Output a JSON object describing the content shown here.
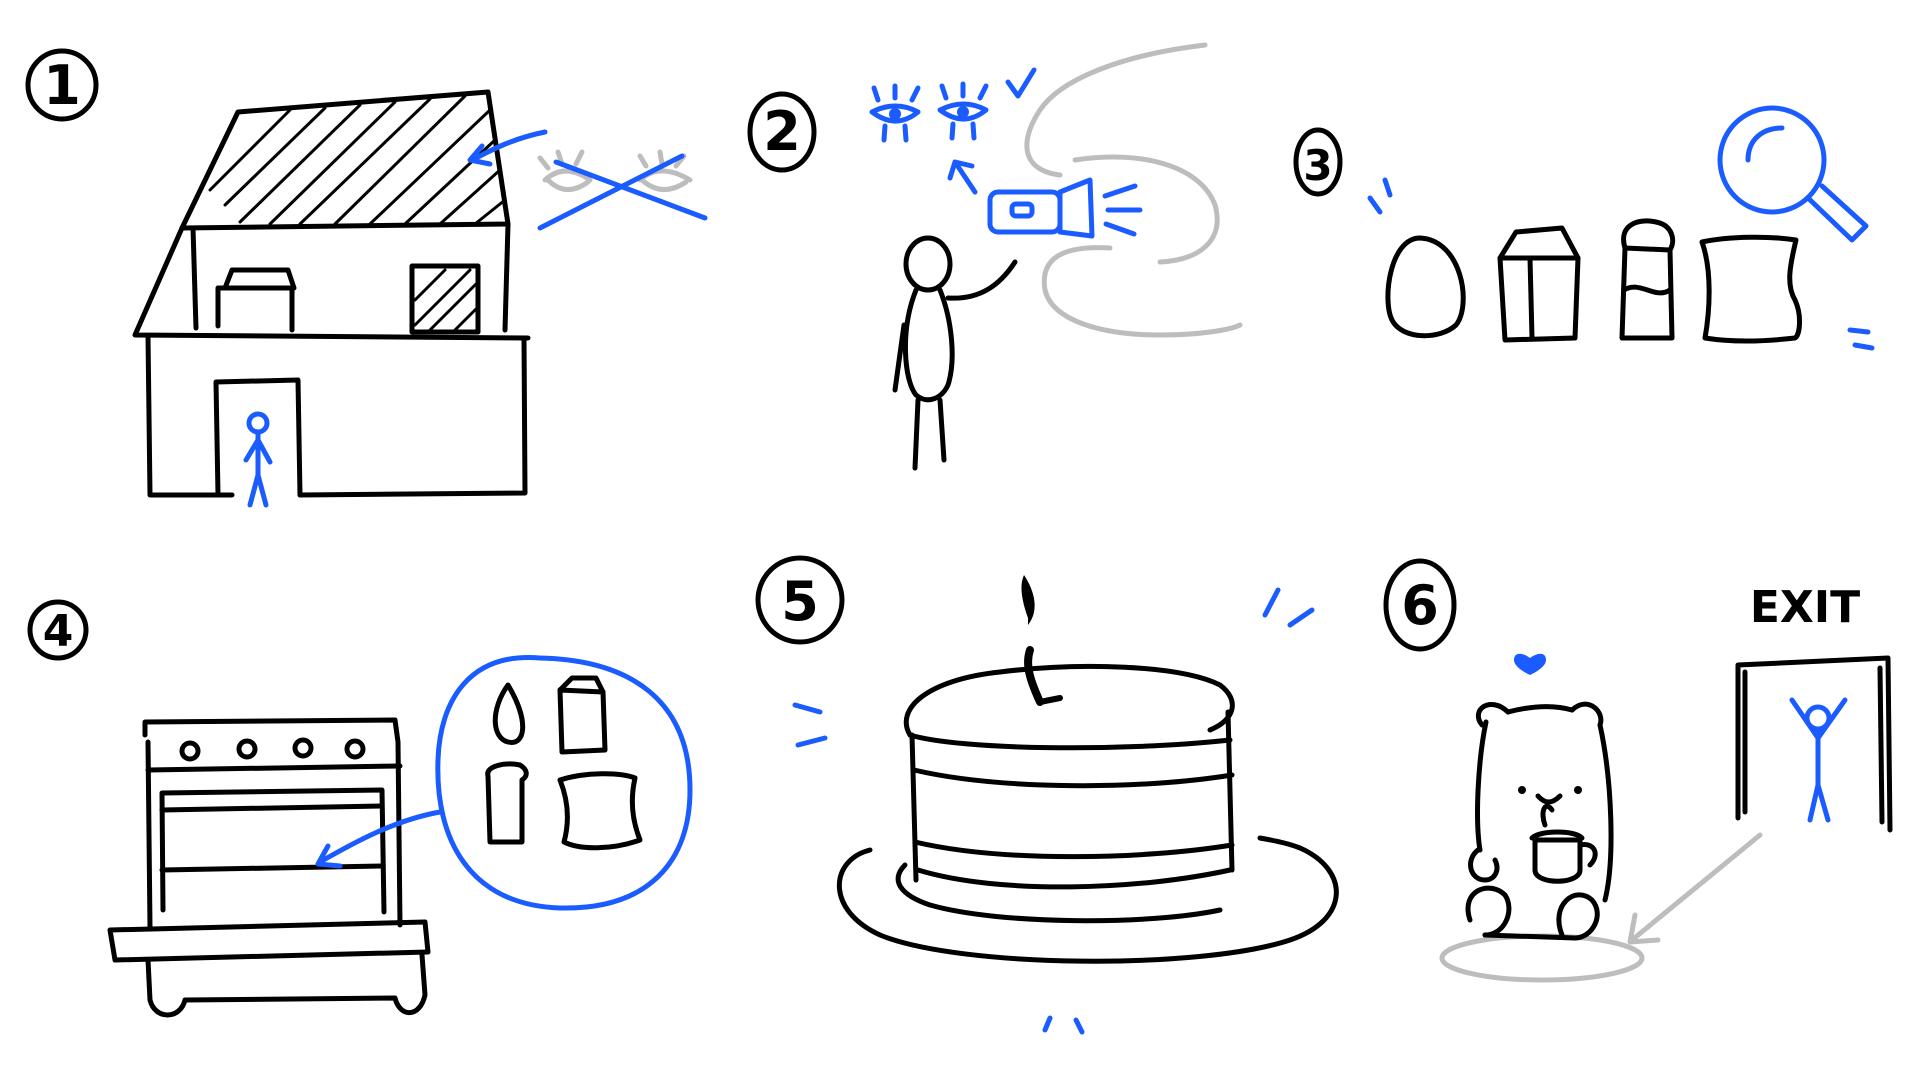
{
  "colors": {
    "ink": "#000000",
    "accent": "#1a5cff",
    "muted": "#bdbdbd"
  },
  "steps": [
    {
      "number": "1"
    },
    {
      "number": "2"
    },
    {
      "number": "3"
    },
    {
      "number": "4"
    },
    {
      "number": "5"
    },
    {
      "number": "6"
    }
  ],
  "exit_sign": "EXIT",
  "icons": [
    "house-icon",
    "eyes-crossed-icon",
    "flashlight-icon",
    "eyes-icon",
    "checkmark-icon",
    "egg-icon",
    "milk-carton-icon",
    "jar-icon",
    "flour-bag-icon",
    "magnifier-icon",
    "oven-icon",
    "cake-icon",
    "bear-icon",
    "exit-door-icon",
    "heart-icon"
  ]
}
